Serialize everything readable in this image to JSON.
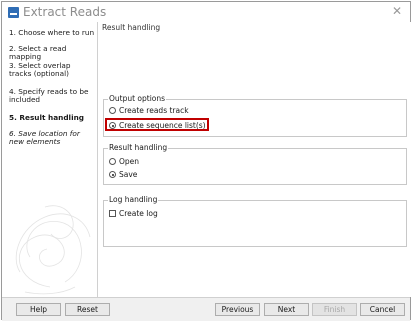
{
  "window": {
    "title": "Extract Reads",
    "close_icon": "close-icon"
  },
  "sidebar": {
    "steps": [
      {
        "label": "1.  Choose where to run"
      },
      {
        "label": "2.  Select a read mapping"
      },
      {
        "label": "3.  Select overlap tracks (optional)"
      },
      {
        "label": "4.  Specify reads to be included"
      },
      {
        "label": "5.  Result handling"
      },
      {
        "label": "6.  Save location for new elements"
      }
    ]
  },
  "content": {
    "title": "Result handling",
    "output_options": {
      "title": "Output options",
      "option1": "Create reads track",
      "option2": "Create sequence list(s)"
    },
    "result_handling": {
      "title": "Result handling",
      "option1": "Open",
      "option2": "Save"
    },
    "log_handling": {
      "title": "Log handling",
      "checkbox": "Create log"
    }
  },
  "footer": {
    "help": "Help",
    "reset": "Reset",
    "previous": "Previous",
    "next": "Next",
    "finish": "Finish",
    "cancel": "Cancel"
  },
  "colors": {
    "highlight": "#c00000",
    "app_icon": "#2f6db5"
  }
}
